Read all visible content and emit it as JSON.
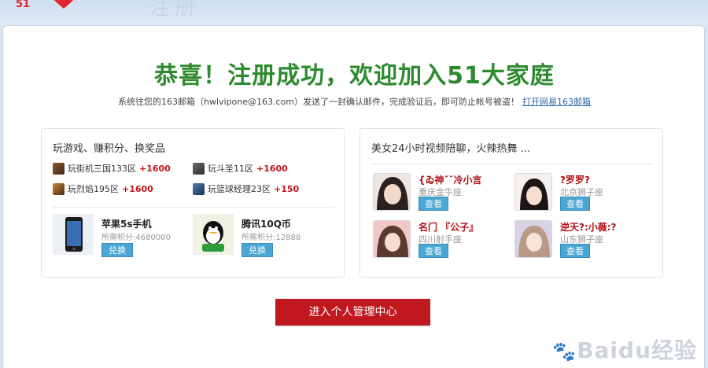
{
  "header": {
    "logo_text": "51",
    "bg_word": "注册"
  },
  "main": {
    "headline": "恭喜！注册成功，欢迎加入51大家庭",
    "subline": "系统往您的163邮箱（hwlvipone@163.com）发送了一封确认邮件，完成验证后，即可防止帐号被盗！",
    "open_mail_link": "打开网易163邮箱"
  },
  "games_panel": {
    "title": "玩游戏、赚积分、换奖品",
    "games": [
      {
        "name": "玩街机三国133区",
        "points": "+1600",
        "icon": "game-icon"
      },
      {
        "name": "玩斗圣11区",
        "points": "+1600",
        "icon": "game-icon"
      },
      {
        "name": "玩烈焰195区",
        "points": "+1600",
        "icon": "game-icon"
      },
      {
        "name": "玩篮球经理23区",
        "points": "+150",
        "icon": "game-icon"
      }
    ],
    "prizes": [
      {
        "name": "苹果5s手机",
        "cost": "所需积分:4680000",
        "button": "兑换",
        "icon": "iphone-image"
      },
      {
        "name": "腾讯10Q币",
        "cost": "所需积分:12888",
        "button": "兑换",
        "icon": "qq-coin-image"
      }
    ]
  },
  "video_panel": {
    "title": "美女24小时视频陪聊，火辣热舞 ...",
    "girls": [
      {
        "name": "{ゐ神ˇˇ冷小言",
        "location": "重庆金牛座",
        "button": "查看"
      },
      {
        "name": "?罗罗?",
        "location": "北京狮子座",
        "button": "查看"
      },
      {
        "name": "名门 『公子』",
        "location": "四川射手座",
        "button": "查看"
      },
      {
        "name": "逆天?:小薇:?",
        "location": "山东狮子座",
        "button": "查看"
      }
    ]
  },
  "cta": {
    "label": "进入个人管理中心"
  },
  "watermark": {
    "text": "Baidu经验"
  },
  "colors": {
    "headline": "#2d8a2d",
    "cta": "#c11820",
    "button": "#4aa6d3",
    "points": "#c0161b"
  }
}
